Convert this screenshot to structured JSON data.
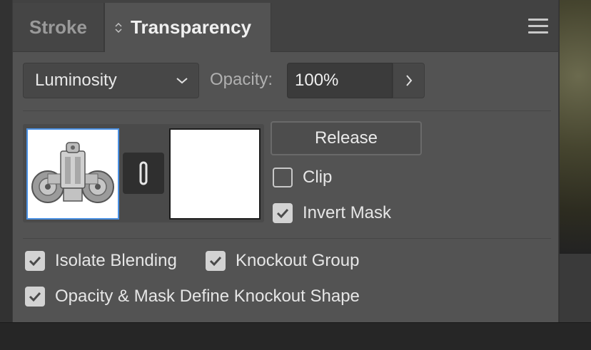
{
  "tabs": [
    {
      "label": "Stroke",
      "active": false
    },
    {
      "label": "Transparency",
      "active": true
    }
  ],
  "blend_mode": {
    "selected": "Luminosity"
  },
  "opacity": {
    "label": "Opacity:",
    "value": "100%"
  },
  "mask": {
    "release_label": "Release",
    "clip": {
      "label": "Clip",
      "checked": false
    },
    "invert_mask": {
      "label": "Invert Mask",
      "checked": true
    }
  },
  "options": {
    "isolate_blending": {
      "label": "Isolate Blending",
      "checked": true
    },
    "knockout_group": {
      "label": "Knockout Group",
      "checked": true
    },
    "opacity_mask_knockout": {
      "label": "Opacity & Mask Define Knockout Shape",
      "checked": true
    }
  },
  "colors": {
    "panel_bg": "#535353",
    "tabbar_bg": "#424242",
    "selection_blue": "#4a90e2",
    "checkbox_fill": "#d3d3d3"
  },
  "icons": [
    "panel-menu-icon",
    "chevron-down-icon",
    "chevron-right-icon",
    "link-icon",
    "checkmark-icon",
    "tab-arrows-icon"
  ]
}
